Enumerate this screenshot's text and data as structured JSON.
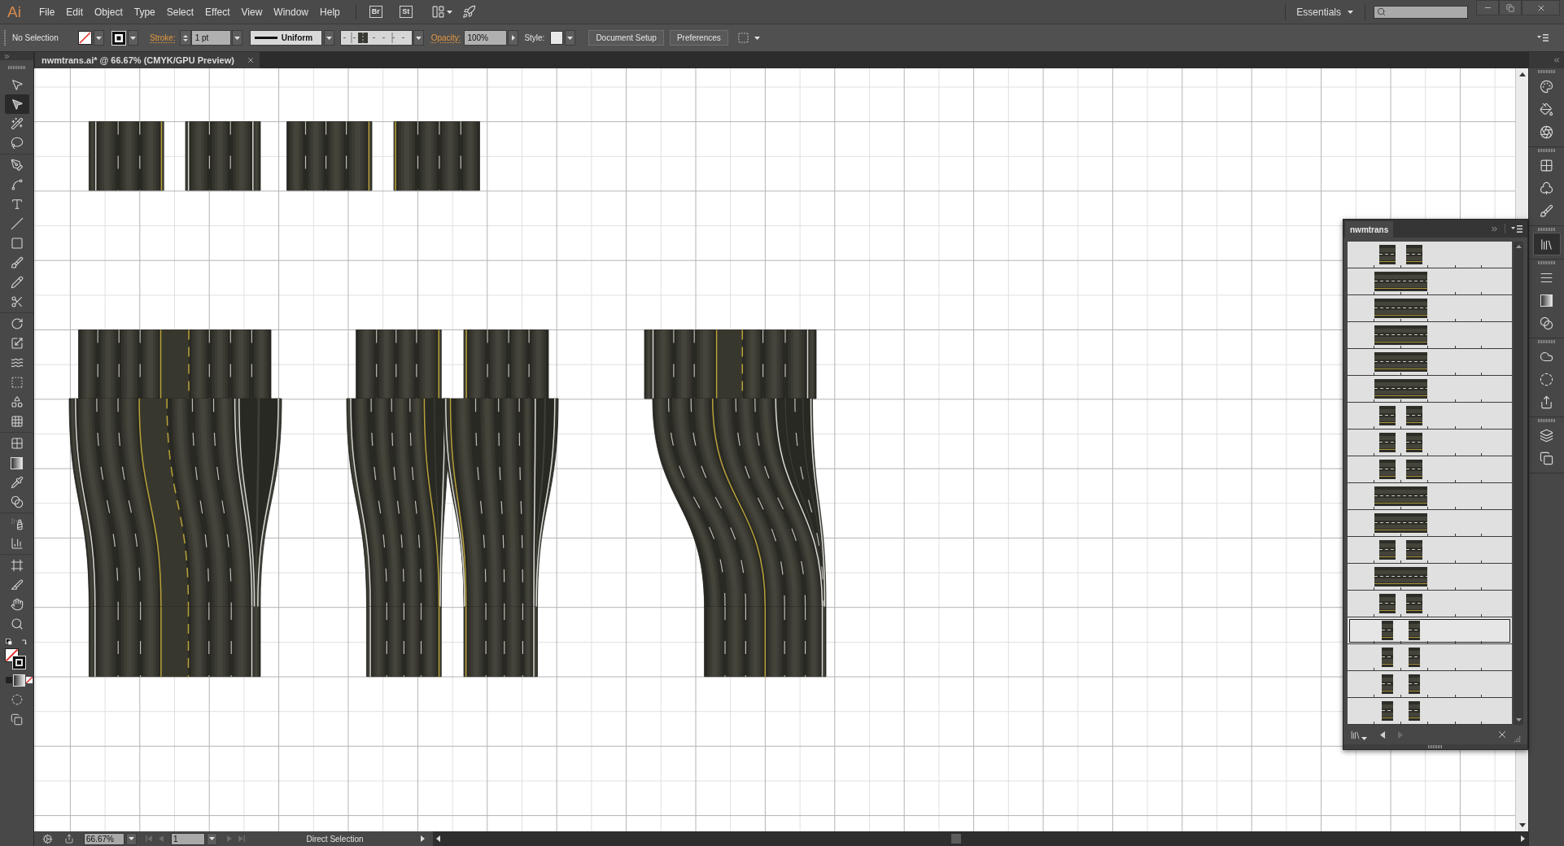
{
  "menu_bar": {
    "logo": "Ai",
    "menus": [
      "File",
      "Edit",
      "Object",
      "Type",
      "Select",
      "Effect",
      "View",
      "Window",
      "Help"
    ],
    "app_buttons": [
      "Br",
      "St"
    ],
    "workspace": "Essentials"
  },
  "control_bar": {
    "selection": "No Selection",
    "stroke_label": "Stroke:",
    "stroke_weight": "1 pt",
    "stroke_profile": "Uniform",
    "opacity_label": "Opacity:",
    "opacity": "100%",
    "style_label": "Style:",
    "buttons": [
      "Document Setup",
      "Preferences"
    ]
  },
  "document_tab": {
    "title": "nwmtrans.ai* @ 66.67% (CMYK/GPU Preview)"
  },
  "tools": [
    [
      {
        "kind": "selection",
        "selected": false
      },
      {
        "kind": "direct",
        "selected": true
      },
      {
        "kind": "wand",
        "selected": false
      },
      {
        "kind": "lasso",
        "selected": false
      }
    ],
    [
      {
        "kind": "pen",
        "selected": false
      },
      {
        "kind": "curvature",
        "selected": false
      },
      {
        "kind": "type",
        "selected": false
      },
      {
        "kind": "line",
        "selected": false
      },
      {
        "kind": "rectangle",
        "selected": false
      },
      {
        "kind": "brush",
        "selected": false
      },
      {
        "kind": "pencil",
        "selected": false
      },
      {
        "kind": "scissors",
        "selected": false
      }
    ],
    [
      {
        "kind": "rotate",
        "selected": false
      },
      {
        "kind": "scale",
        "selected": false
      },
      {
        "kind": "width",
        "selected": false
      },
      {
        "kind": "transform",
        "selected": false
      },
      {
        "kind": "builder",
        "selected": false
      },
      {
        "kind": "perspective",
        "selected": false
      }
    ],
    [
      {
        "kind": "mesh",
        "selected": false
      },
      {
        "kind": "gradient",
        "selected": false
      },
      {
        "kind": "eyedropper",
        "selected": false
      },
      {
        "kind": "blend",
        "selected": false
      }
    ],
    [
      {
        "kind": "sprayer",
        "selected": false
      },
      {
        "kind": "graph",
        "selected": false
      }
    ],
    [
      {
        "kind": "artboard",
        "selected": false
      },
      {
        "kind": "slice",
        "selected": false
      },
      {
        "kind": "hand",
        "selected": false
      },
      {
        "kind": "zoom",
        "selected": false
      }
    ]
  ],
  "panel": {
    "title": "nwmtrans",
    "items": [
      {
        "kind": "split",
        "selected": false
      },
      {
        "kind": "joined",
        "selected": false
      },
      {
        "kind": "joined",
        "selected": false
      },
      {
        "kind": "joined",
        "selected": false
      },
      {
        "kind": "joined",
        "selected": false
      },
      {
        "kind": "joined",
        "selected": false
      },
      {
        "kind": "split",
        "selected": false
      },
      {
        "kind": "split",
        "selected": false
      },
      {
        "kind": "split",
        "selected": false
      },
      {
        "kind": "joined",
        "selected": false
      },
      {
        "kind": "joined",
        "selected": false
      },
      {
        "kind": "split",
        "selected": false
      },
      {
        "kind": "joined",
        "selected": false
      },
      {
        "kind": "split",
        "selected": false
      },
      {
        "kind": "narrow",
        "selected": true
      },
      {
        "kind": "narrow",
        "selected": false
      },
      {
        "kind": "narrow",
        "selected": false
      },
      {
        "kind": "narrow",
        "selected": false
      }
    ],
    "previous_disabled": false,
    "next_disabled": true
  },
  "dock": [
    [
      {
        "kind": "palette",
        "selected": false
      },
      {
        "kind": "bucket",
        "selected": false
      },
      {
        "kind": "aperture",
        "selected": false
      }
    ],
    [
      {
        "kind": "swatches",
        "selected": false
      },
      {
        "kind": "symbols",
        "selected": false
      },
      {
        "kind": "brushes",
        "selected": false
      }
    ],
    [
      {
        "kind": "library",
        "selected": true
      }
    ],
    [
      {
        "kind": "stroke",
        "selected": false
      },
      {
        "kind": "gradient",
        "selected": false
      },
      {
        "kind": "transparency",
        "selected": false
      }
    ],
    [
      {
        "kind": "cloud",
        "selected": false
      },
      {
        "kind": "appearance",
        "selected": false
      },
      {
        "kind": "export",
        "selected": false
      }
    ],
    [
      {
        "kind": "layers",
        "selected": false
      },
      {
        "kind": "artboards",
        "selected": false
      }
    ]
  ],
  "status_bar": {
    "zoom": "66.67%",
    "page": "1",
    "page_nav": [
      {
        "kind": "first",
        "disabled": true
      },
      {
        "kind": "previous",
        "disabled": true
      },
      {
        "kind": "next",
        "disabled": true
      },
      {
        "kind": "last",
        "disabled": true
      }
    ],
    "tool": "Direct Selection"
  }
}
